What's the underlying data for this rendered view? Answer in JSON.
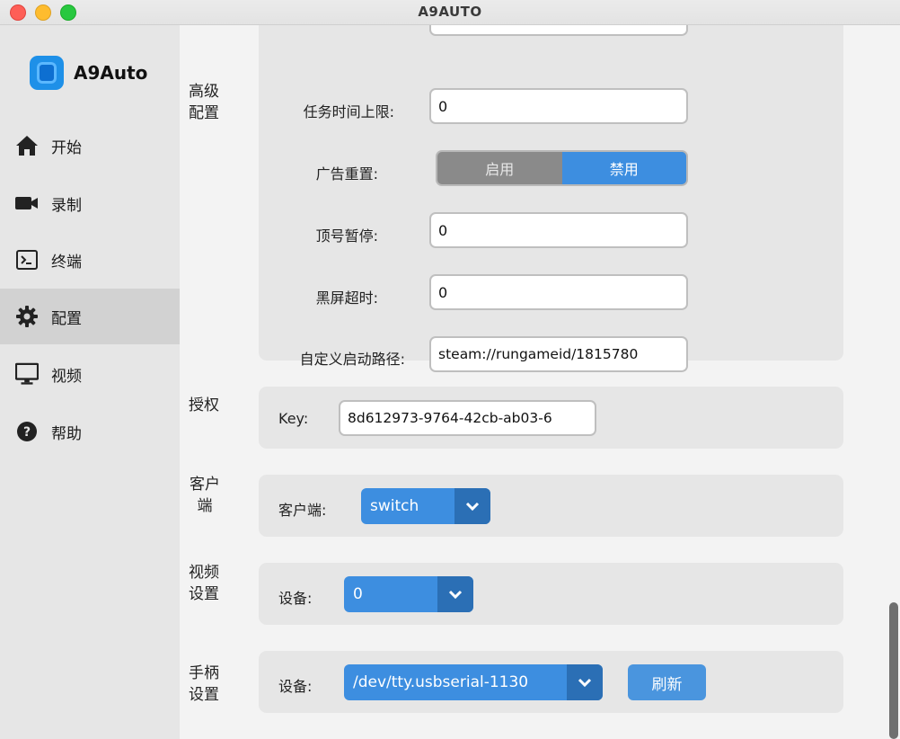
{
  "window": {
    "title": "A9AUTO"
  },
  "sidebar": {
    "brand": "A9Auto",
    "items": [
      {
        "label": "开始",
        "icon": "home-icon"
      },
      {
        "label": "录制",
        "icon": "video-camera-icon"
      },
      {
        "label": "终端",
        "icon": "terminal-icon"
      },
      {
        "label": "配置",
        "icon": "gear-icon",
        "active": true
      },
      {
        "label": "视频",
        "icon": "monitor-icon"
      },
      {
        "label": "帮助",
        "icon": "help-icon"
      }
    ]
  },
  "advanced": {
    "section_label": "高级配置",
    "task_time_limit": {
      "label": "任务时间上限:",
      "value": "0"
    },
    "ad_reset": {
      "label": "广告重置:",
      "options": [
        "启用",
        "禁用"
      ],
      "selected": "禁用"
    },
    "top_pause": {
      "label": "顶号暂停:",
      "value": "0"
    },
    "black_screen_timeout": {
      "label": "黑屏超时:",
      "value": "0"
    },
    "custom_launch_path": {
      "label": "自定义启动路径:",
      "value": "steam://rungameid/1815780"
    }
  },
  "auth": {
    "section_label": "授权",
    "key": {
      "label": "Key:",
      "value": "8d612973-9764-42cb-ab03-6"
    }
  },
  "client": {
    "section_label": "客户端",
    "field_label": "客户端:",
    "selected": "switch"
  },
  "video": {
    "section_label": "视频设置",
    "field_label": "设备:",
    "selected": "0"
  },
  "gamepad": {
    "section_label": "手柄设置",
    "field_label": "设备:",
    "selected": "/dev/tty.usbserial-1130",
    "refresh_label": "刷新"
  },
  "colors": {
    "accent": "#3d8ee0",
    "accent_dark": "#2b6fb5",
    "active_nav": "#d2d2d2"
  }
}
